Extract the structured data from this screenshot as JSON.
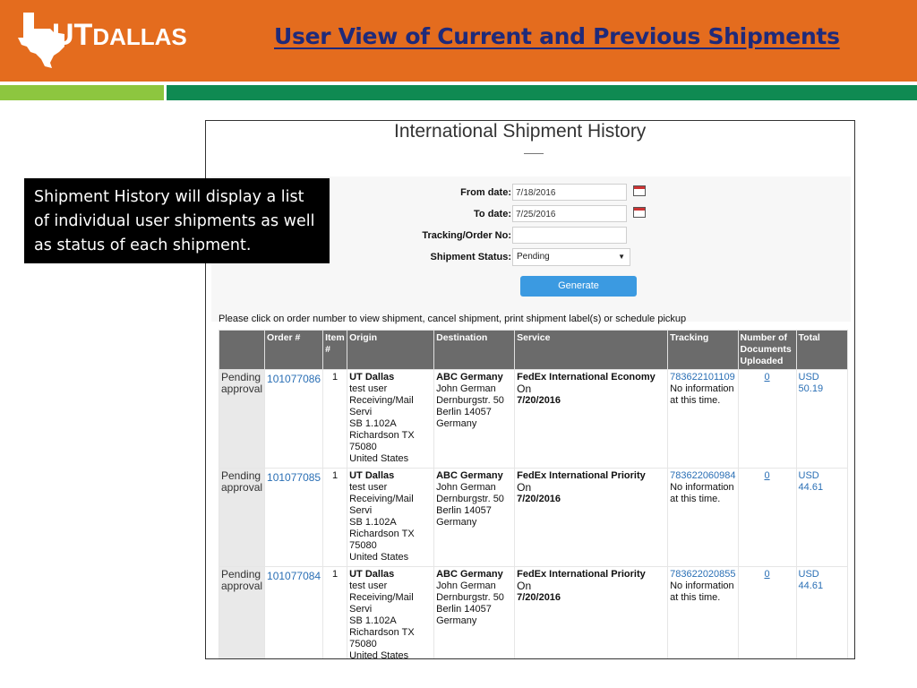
{
  "logo": {
    "text_ut": "UT",
    "text_rest": "DALLAS"
  },
  "slide_title": "User View of Current and Previous Shipments",
  "colors": {
    "header": "#e46c1e",
    "stripe_light": "#8dc63f",
    "stripe_dark": "#0f8a52",
    "title": "#1f2a7a",
    "button": "#3b9ae1",
    "link": "#2a6fb5"
  },
  "note": "Shipment History will display a list of individual user shipments as well as status of each shipment.",
  "app": {
    "title": "International Shipment History",
    "form": {
      "from_label": "From date:",
      "from_value": "7/18/2016",
      "to_label": "To date:",
      "to_value": "7/25/2016",
      "tracking_label": "Tracking/Order No:",
      "tracking_value": "",
      "status_label": "Shipment Status:",
      "status_value": "Pending",
      "generate_label": "Generate",
      "icons": {
        "calendar": "calendar-icon",
        "dropdown": "chevron-down-icon"
      }
    },
    "instruction": "Please click on order number to view shipment, cancel shipment, print shipment label(s) or schedule pickup",
    "columns": {
      "status": "",
      "order": "Order #",
      "item": "Item #",
      "origin": "Origin",
      "destination": "Destination",
      "service": "Service",
      "tracking": "Tracking",
      "docs": "Number of Documents Uploaded",
      "total": "Total"
    },
    "rows": [
      {
        "status": "Pending approval",
        "order": "101077086",
        "item": "1",
        "origin_name": "UT Dallas",
        "origin_lines": [
          "test user",
          "Receiving/Mail Servi",
          "SB 1.102A",
          "Richardson TX 75080",
          "United States"
        ],
        "dest_name": "ABC Germany",
        "dest_lines": [
          "John German",
          "Dernburgstr. 50",
          "Berlin 14057",
          "Germany"
        ],
        "service": "FedEx International Economy",
        "on_label": "On",
        "service_date": "7/20/2016",
        "tracking": "783622101109",
        "tracking_note": "No information at this time.",
        "docs": "0",
        "total": "USD 50.19"
      },
      {
        "status": "Pending approval",
        "order": "101077085",
        "item": "1",
        "origin_name": "UT Dallas",
        "origin_lines": [
          "test user",
          "Receiving/Mail Servi",
          "SB 1.102A",
          "Richardson TX 75080",
          "United States"
        ],
        "dest_name": "ABC Germany",
        "dest_lines": [
          "John German",
          "Dernburgstr. 50",
          "Berlin 14057",
          "Germany"
        ],
        "service": "FedEx International Priority",
        "on_label": "On",
        "service_date": "7/20/2016",
        "tracking": "783622060984",
        "tracking_note": "No information at this time.",
        "docs": "0",
        "total": "USD 44.61"
      },
      {
        "status": "Pending approval",
        "order": "101077084",
        "item": "1",
        "origin_name": "UT Dallas",
        "origin_lines": [
          "test user",
          "Receiving/Mail Servi",
          "SB 1.102A",
          "Richardson TX 75080",
          "United States"
        ],
        "dest_name": "ABC Germany",
        "dest_lines": [
          "John German",
          "Dernburgstr. 50",
          "Berlin 14057",
          "Germany"
        ],
        "service": "FedEx International Priority",
        "on_label": "On",
        "service_date": "7/20/2016",
        "tracking": "783622020855",
        "tracking_note": "No information at this time.",
        "docs": "0",
        "total": "USD 44.61"
      }
    ]
  }
}
